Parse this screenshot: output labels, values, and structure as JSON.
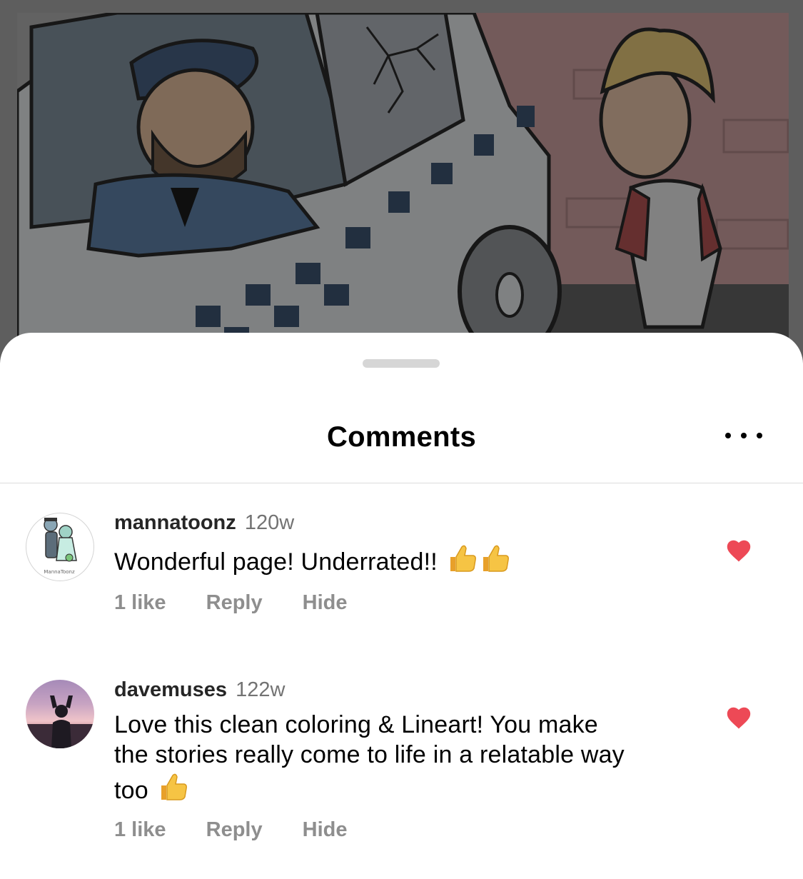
{
  "sheet": {
    "title": "Comments"
  },
  "comments": [
    {
      "username": "mannatoonz",
      "time": "120w",
      "text": "Wonderful page! Underrated!!",
      "likes": "1 like",
      "reply_label": "Reply",
      "hide_label": "Hide",
      "avatar_caption": "MannaToonz",
      "liked": true
    },
    {
      "username": "davemuses",
      "time": "122w",
      "text_line1": "Love this clean coloring & Lineart! You make",
      "text_line2": "the stories really come to life in a relatable way",
      "text_line3": "too",
      "likes": "1 like",
      "reply_label": "Reply",
      "hide_label": "Hide",
      "liked": true
    }
  ],
  "colors": {
    "heart": "#ed4956",
    "secondary_text": "#8e8e8e",
    "divider": "#dbdbdb",
    "thumb": "#f6c444"
  },
  "icons": {
    "more": "more-horizontal-icon",
    "heart": "heart-filled-icon",
    "emoji": "thumbs-up-emoji"
  }
}
